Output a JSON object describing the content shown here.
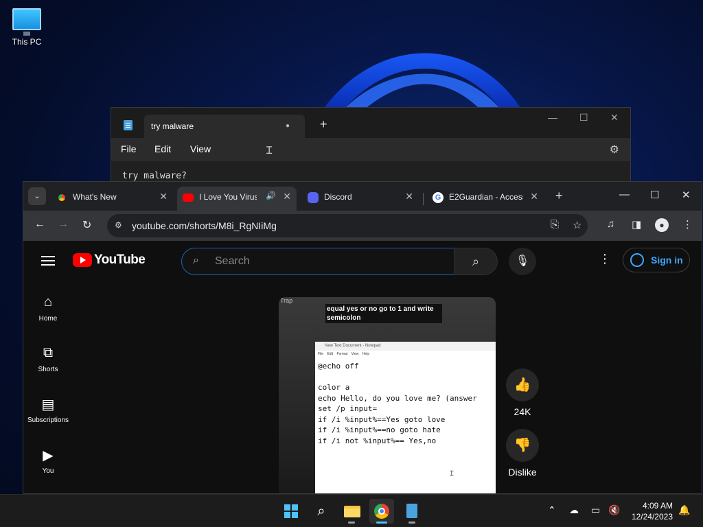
{
  "desktop": {
    "icons": [
      {
        "label": "This PC"
      }
    ]
  },
  "notepad": {
    "tab_title": "try malware",
    "tab_modified_indicator": "●",
    "new_tab": "+",
    "window_controls": {
      "minimize": "—",
      "maximize": "☐",
      "close": "✕"
    },
    "menu": {
      "file": "File",
      "edit": "Edit",
      "view": "View"
    },
    "content": "try malware?"
  },
  "chrome": {
    "tabs": [
      {
        "title": "What's New",
        "favicon": "chrome-icon"
      },
      {
        "title": "I Love You Virus",
        "favicon": "youtube-icon",
        "active": true,
        "audio": true
      },
      {
        "title": "Discord",
        "favicon": "discord-icon"
      },
      {
        "title": "E2Guardian - Access",
        "favicon": "google-icon"
      }
    ],
    "new_tab": "+",
    "window_controls": {
      "minimize": "—",
      "maximize": "☐",
      "close": "✕"
    },
    "url": "youtube.com/shorts/M8i_RgNIiMg"
  },
  "youtube": {
    "logo_text": "YouTube",
    "search_placeholder": "Search",
    "sign_in": "Sign in",
    "sidebar": [
      {
        "label": "Home",
        "icon": "home-icon"
      },
      {
        "label": "Shorts",
        "icon": "shorts-icon"
      },
      {
        "label": "Subscriptions",
        "icon": "subscriptions-icon"
      },
      {
        "label": "You",
        "icon": "you-icon"
      }
    ],
    "video": {
      "corner_label": "Trap",
      "caption": "equal yes or no go to 1 and write semicolon",
      "embedded_notepad": {
        "title": "New Text Document - Notepad",
        "menu": "File Edit Format View Help",
        "lines": [
          "@echo off",
          "",
          "color a",
          "echo Hello, do you love me? (answer",
          "set /p input=",
          "if /i %input%==Yes goto love",
          "if /i %input%==no goto hate",
          "if /i not %input%== Yes,no"
        ]
      }
    },
    "actions": {
      "like_count": "24K",
      "dislike_label": "Dislike"
    }
  },
  "taskbar": {
    "apps": [
      "start",
      "search",
      "file-explorer",
      "chrome",
      "notepad"
    ],
    "time": "4:09 AM",
    "date": "12/24/2023"
  },
  "colors": {
    "youtube_red": "#ff0000",
    "link_blue": "#3ea6ff",
    "search_focus": "#1c62b9",
    "windows_accent": "#4cc2ff"
  }
}
